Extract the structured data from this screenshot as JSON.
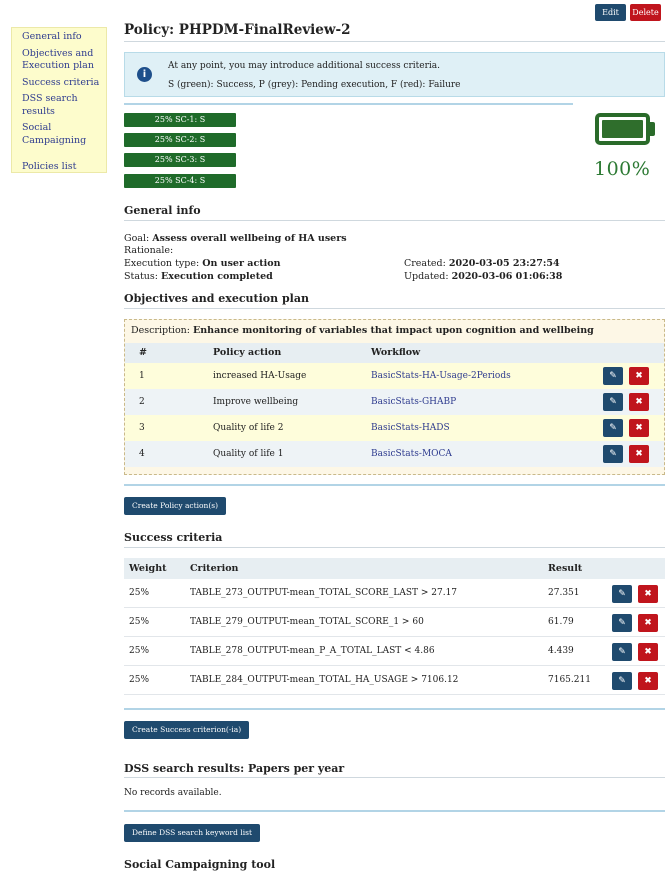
{
  "sidebar": {
    "items": [
      {
        "label": "General info"
      },
      {
        "label": "Objectives and Execution plan"
      },
      {
        "label": "Success criteria"
      },
      {
        "label": "DSS search results"
      },
      {
        "label": "Social Campaigning"
      },
      {
        "label": "Policies list"
      }
    ]
  },
  "toolbar": {
    "edit_label": "Edit",
    "delete_label": "Delete"
  },
  "page": {
    "title": "Policy: PHPDM-FinalReview-2"
  },
  "info": {
    "line1": "At any point, you may introduce additional success criteria.",
    "line2": "S (green): Success, P (grey): Pending execution, F (red): Failure",
    "icon": "i"
  },
  "badges": [
    {
      "label": "25% SC-1: S"
    },
    {
      "label": "25% SC-2: S"
    },
    {
      "label": "25% SC-3: S"
    },
    {
      "label": "25% SC-4: S"
    }
  ],
  "battery": {
    "percent_text": "100%",
    "level": 1.0,
    "color": "#2a6b2a"
  },
  "general_info": {
    "heading": "General info",
    "goal_label": "Goal:",
    "goal_value": "Assess overall wellbeing of HA users",
    "rationale_label": "Rationale:",
    "exec_type_label": "Execution type:",
    "exec_type_value": "On user action",
    "status_label": "Status:",
    "status_value": "Execution completed",
    "created_label": "Created:",
    "created_value": "2020-03-05 23:27:54",
    "updated_label": "Updated:",
    "updated_value": "2020-03-06 01:06:38"
  },
  "objectives": {
    "heading": "Objectives and execution plan",
    "desc_label": "Description:",
    "desc_value": "Enhance monitoring of variables that impact upon cognition and wellbeing",
    "columns": [
      "#",
      "Policy action",
      "Workflow"
    ],
    "rows": [
      {
        "num": "1",
        "action": "increased HA-Usage",
        "workflow": "BasicStats-HA-Usage-2Periods"
      },
      {
        "num": "2",
        "action": "Improve wellbeing",
        "workflow": "BasicStats-GHABP"
      },
      {
        "num": "3",
        "action": "Quality of life 2",
        "workflow": "BasicStats-HADS"
      },
      {
        "num": "4",
        "action": "Quality of life 1",
        "workflow": "BasicStats-MOCA"
      }
    ],
    "create_button": "Create Policy action(s)"
  },
  "success_criteria": {
    "heading": "Success criteria",
    "columns": [
      "Weight",
      "Criterion",
      "Result"
    ],
    "rows": [
      {
        "weight": "25%",
        "criterion": "TABLE_273_OUTPUT-mean_TOTAL_SCORE_LAST > 27.17",
        "result": "27.351"
      },
      {
        "weight": "25%",
        "criterion": "TABLE_279_OUTPUT-mean_TOTAL_SCORE_1 > 60",
        "result": "61.79"
      },
      {
        "weight": "25%",
        "criterion": "TABLE_278_OUTPUT-mean_P_A_TOTAL_LAST < 4.86",
        "result": "4.439"
      },
      {
        "weight": "25%",
        "criterion": "TABLE_284_OUTPUT-mean_TOTAL_HA_USAGE > 7106.12",
        "result": "7165.211"
      }
    ],
    "create_button": "Create Success criterion(-ia)"
  },
  "dss": {
    "heading": "DSS search results: Papers per year",
    "empty_text": "No records available.",
    "define_button": "Define DSS search keyword list"
  },
  "social": {
    "heading": "Social Campaigning tool"
  },
  "icons": {
    "edit": "edit-icon",
    "delete": "delete-icon",
    "edit_glyph": "✎",
    "delete_glyph": "✖"
  }
}
